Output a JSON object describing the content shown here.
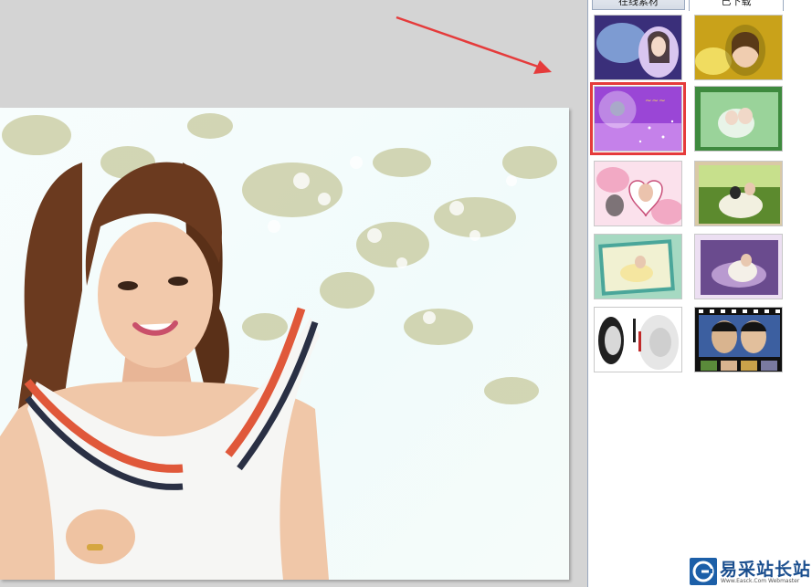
{
  "panel": {
    "tabs": [
      {
        "label": "在线素材",
        "active": false
      },
      {
        "label": "已下载",
        "active": true
      }
    ],
    "thumbnails": [
      {
        "name": "frame-purple-flowers",
        "palette": [
          "#3a2f7a",
          "#8fb7e8",
          "#d9c6f0"
        ],
        "selected": false
      },
      {
        "name": "frame-yellow-lily",
        "palette": [
          "#c9a21a",
          "#f0dc60",
          "#7d6a10"
        ],
        "selected": false
      },
      {
        "name": "frame-purple-bubble",
        "palette": [
          "#9a46d6",
          "#d79af2",
          "#ffffff"
        ],
        "selected": true
      },
      {
        "name": "frame-green-wedding",
        "palette": [
          "#3e8a3e",
          "#9ad39a",
          "#e8f4e8"
        ],
        "selected": false
      },
      {
        "name": "frame-pink-heart",
        "palette": [
          "#f2a9c4",
          "#fbe1ec",
          "#c9507a"
        ],
        "selected": false
      },
      {
        "name": "frame-green-field-couple",
        "palette": [
          "#5c8a2e",
          "#c7e08c",
          "#f2f0e0"
        ],
        "selected": false
      },
      {
        "name": "frame-teal-picnic",
        "palette": [
          "#4aa69a",
          "#a6d9c2",
          "#f1f1d2"
        ],
        "selected": false
      },
      {
        "name": "frame-purple-lake",
        "palette": [
          "#6a4b8e",
          "#b99ad0",
          "#ecdff2"
        ],
        "selected": false
      },
      {
        "name": "frame-black-white-happiness",
        "palette": [
          "#202020",
          "#d8d8d8",
          "#c02a2a"
        ],
        "selected": false
      },
      {
        "name": "frame-film-strip",
        "palette": [
          "#111111",
          "#3c5fa0",
          "#d9b48f"
        ],
        "selected": false
      }
    ]
  },
  "annotation": {
    "arrow_color": "#e53b3b"
  },
  "watermark": {
    "title": "易采站长站",
    "url": "Www.Easck.Com Webmaster"
  },
  "colors": {
    "canvas_bg": "#d4d4d4",
    "panel_border": "#9aa9bf",
    "selection": "#e53b3b"
  }
}
